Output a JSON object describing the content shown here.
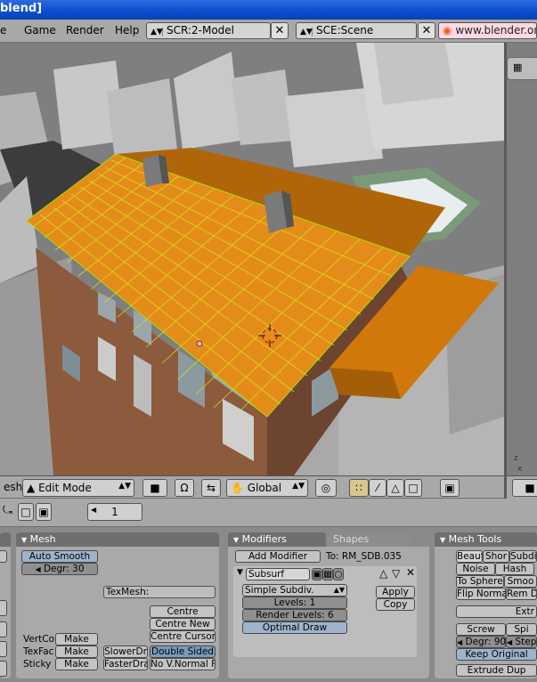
{
  "window": {
    "title": "blend]"
  },
  "menubar": {
    "items": [
      "e",
      "Game",
      "Render",
      "Help"
    ],
    "screen_field": "SCR:2-Model",
    "scene_field": "SCE:Scene",
    "url": "www.blender.org"
  },
  "header3d": {
    "mesh_label": "esh",
    "mode": "Edit Mode",
    "orientation": "Global"
  },
  "buttons_header": {
    "frame": "1"
  },
  "panels": {
    "mesh": {
      "title": "Mesh",
      "auto_smooth": "Auto Smooth",
      "degr": "Degr: 30",
      "texmesh": "TexMesh:",
      "centre": "Centre",
      "centre_new": "Centre New",
      "centre_cursor": "Centre Cursor",
      "vertco": "VertCo",
      "texfac": "TexFac",
      "sticky": "Sticky",
      "make": "Make",
      "slower_draw": "SlowerDr",
      "faster_draw": "FasterDra",
      "double_sided": "Double Sided",
      "no_vnormal": "No V.Normal F"
    },
    "modifiers": {
      "tab_modifiers": "Modifiers",
      "tab_shapes": "Shapes",
      "add_modifier": "Add Modifier",
      "to_object": "To: RM_SDB.035",
      "modifier_name": "Subsurf",
      "subdiv_type": "Simple Subdiv.",
      "levels": "Levels: 1",
      "render_levels": "Render Levels: 6",
      "optimal_draw": "Optimal Draw",
      "apply": "Apply",
      "copy": "Copy"
    },
    "mesh_tools": {
      "title": "Mesh Tools",
      "beauty": "Beaut",
      "short": "Shor",
      "subdivide": "Subdiv",
      "noise": "Noise",
      "hash": "Hash",
      "to_sphere": "To Sphere",
      "smooth": "Smoo",
      "flip_normal": "Flip Normal",
      "rem_doubles": "Rem D",
      "extrude": "Extr",
      "screw": "Screw",
      "spin": "Spi",
      "degr": "Degr: 90",
      "steps": "Steps",
      "keep_original": "Keep Original",
      "extrude_dup": "Extrude Dup"
    }
  },
  "colors": {
    "roof": "#e8901a",
    "roof_dark": "#b36a0c",
    "wall": "#8a5a3a",
    "ui_gray": "#a8a8a8",
    "title_blue": "#0a4fd0"
  }
}
